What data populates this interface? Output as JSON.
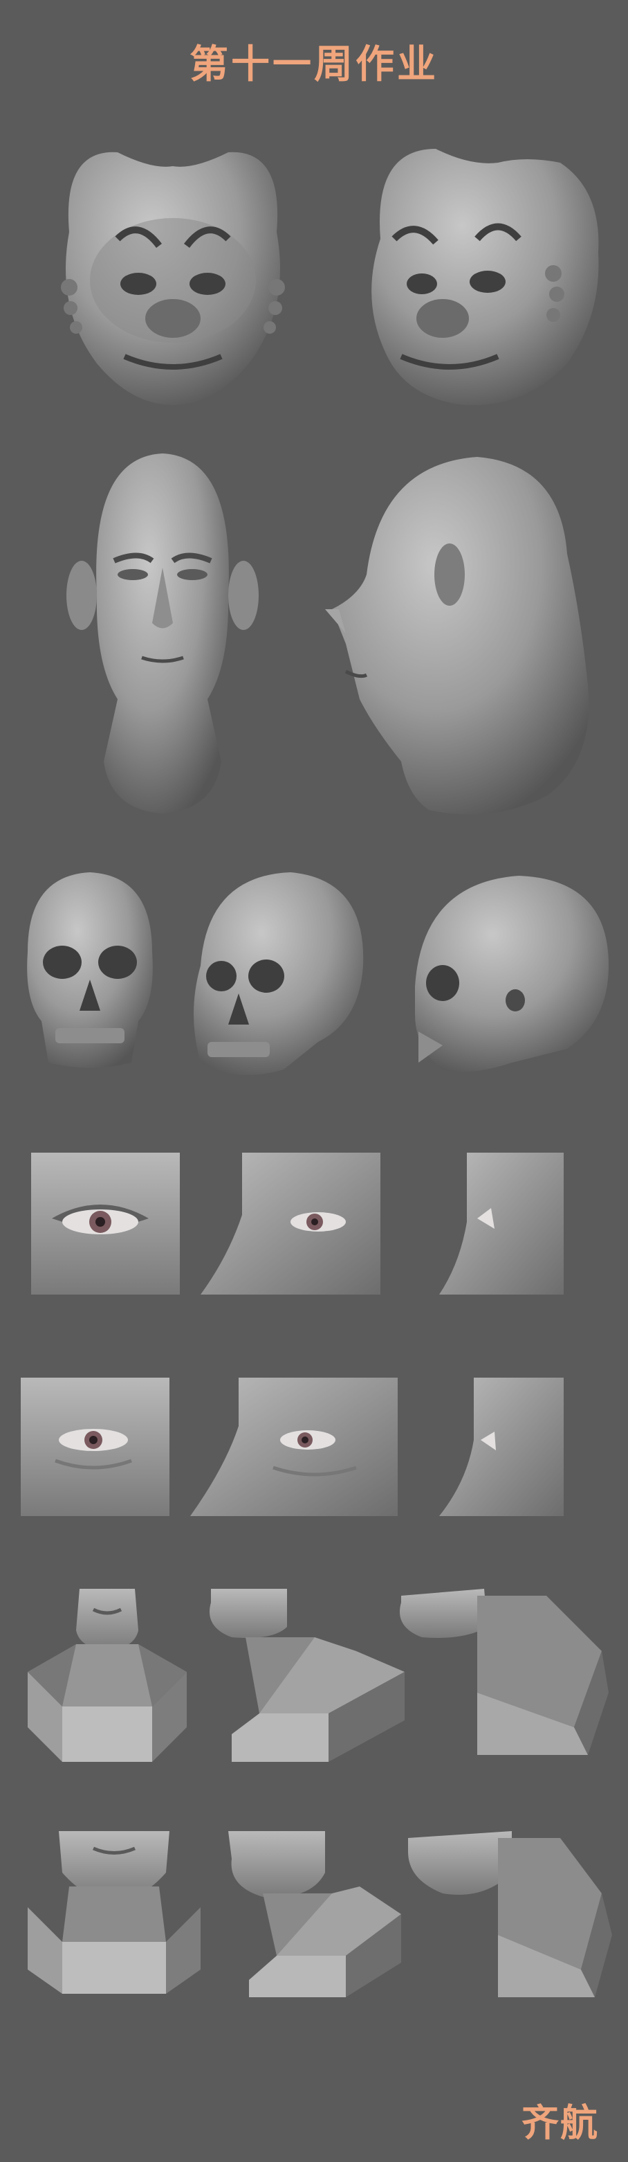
{
  "title": "第十一周作业",
  "signature": "齐航",
  "colors": {
    "background": "#5b5b5b",
    "accent": "#f0a57c",
    "clay_light": "#bdbdbd",
    "clay_mid": "#8f8f8f",
    "clay_dark": "#4f4f4f",
    "eye_iris": "#7a5a5e"
  },
  "rows": [
    {
      "name": "creature-heads",
      "figures": [
        "creature-head-front",
        "creature-head-three-quarter"
      ]
    },
    {
      "name": "human-heads",
      "figures": [
        "head-front",
        "head-side"
      ]
    },
    {
      "name": "skulls",
      "figures": [
        "skull-front",
        "skull-three-quarter",
        "skull-side"
      ]
    },
    {
      "name": "eye-studies-simple",
      "figures": [
        "eye-front",
        "eye-three-quarter",
        "eye-side"
      ]
    },
    {
      "name": "eye-studies-detailed",
      "figures": [
        "eye-detail-front",
        "eye-detail-three-quarter",
        "eye-detail-side"
      ]
    },
    {
      "name": "mouth-neck-studies-1",
      "figures": [
        "mouth-neck-front",
        "mouth-neck-three-quarter",
        "mouth-neck-side"
      ]
    },
    {
      "name": "mouth-neck-studies-2",
      "figures": [
        "lower-face-neck-front",
        "lower-face-neck-three-quarter",
        "lower-face-neck-side"
      ]
    }
  ]
}
